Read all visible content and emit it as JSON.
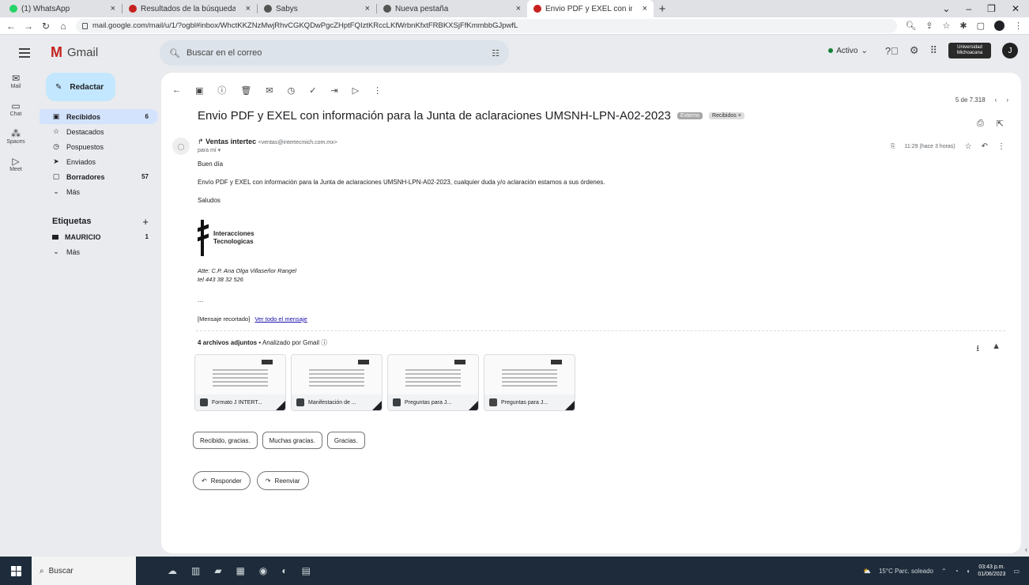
{
  "browser": {
    "tabs": [
      {
        "title": "(1) WhatsApp",
        "active": false
      },
      {
        "title": "Resultados de la búsqueda - jar",
        "active": false
      },
      {
        "title": "Sabys",
        "active": false
      },
      {
        "title": "Nueva pestaña",
        "active": false
      },
      {
        "title": "Envio PDF y EXEL con informac",
        "active": true
      }
    ],
    "url": "mail.google.com/mail/u/1/?ogbl#inbox/WhctKKZNzMwjRhvCGKQDwPgcZHptFQIztKRccLKfWrbnKfxtFRBKXSjFfKmmbbGJpwfL"
  },
  "gmail": {
    "brand": "Gmail",
    "search_placeholder": "Buscar en el correo",
    "status": "Activo",
    "org_badge": "Universidad Michoacana",
    "avatar_letter": "J",
    "rail": [
      {
        "label": "Mail",
        "icon": "mail-icon"
      },
      {
        "label": "Chat",
        "icon": "chat-icon"
      },
      {
        "label": "Spaces",
        "icon": "spaces-icon"
      },
      {
        "label": "Meet",
        "icon": "meet-icon"
      }
    ],
    "compose_label": "Redactar",
    "nav": [
      {
        "label": "Recibidos",
        "count": "6",
        "icon": "▣",
        "active": true
      },
      {
        "label": "Destacados",
        "count": "",
        "icon": "☆",
        "active": false
      },
      {
        "label": "Pospuestos",
        "count": "",
        "icon": "◷",
        "active": false
      },
      {
        "label": "Enviados",
        "count": "",
        "icon": "➤",
        "active": false
      },
      {
        "label": "Borradores",
        "count": "57",
        "icon": "▢",
        "active": false
      },
      {
        "label": "Más",
        "count": "",
        "icon": "⌄",
        "active": false
      }
    ],
    "labels_title": "Etiquetas",
    "labels": [
      {
        "label": "MAURICIO",
        "count": "1"
      }
    ],
    "labels_more": "Más"
  },
  "email": {
    "pager": "5 de 7.318",
    "subject": "Envio PDF y EXEL con información para la Junta de aclaraciones UMSNH-LPN-A02-2023",
    "chip_external": "Externo",
    "chip_inbox": "Recibidos ×",
    "sender_name": "Ventas intertec",
    "sender_email": "<ventas@intertecmich.com.mx>",
    "to": "para mí ▾",
    "time": "11:29 (hace 3 horas)",
    "greeting": "Buen día",
    "body_text": "Envío PDF y EXEL con información para la Junta de aclaraciones UMSNH-LPN-A02-2023, cualquier duda y/o aclaración estamos a sus órdenes.",
    "closing": "Saludos",
    "signature_company_1": "Interacciones",
    "signature_company_2": "Tecnologicas",
    "signature_attn": "Atte: C.P. Ana Olga Villaseñor Rangel",
    "signature_tel": "tel 443 38 32 526",
    "ellipsis": "...",
    "clipped_label": "[Mensaje recortado]",
    "clipped_link": "Ver todo el mensaje",
    "attachments_title": "4 archivos adjuntos",
    "attachments_scan": "• Analizado por Gmail ⓘ",
    "attachments": [
      {
        "name": "Formato J INTERT..."
      },
      {
        "name": "Manifestación de ..."
      },
      {
        "name": "Preguntas para J..."
      },
      {
        "name": "Preguntas para J..."
      }
    ],
    "smart_replies": [
      "Recibido, gracias.",
      "Muchas gracias.",
      "Gracias."
    ],
    "reply_label": "Responder",
    "forward_label": "Reenviar"
  },
  "taskbar": {
    "search_label": "Buscar",
    "weather": "15°C Parc. soleado",
    "time": "03:43 p.m.",
    "date": "01/06/2023"
  }
}
